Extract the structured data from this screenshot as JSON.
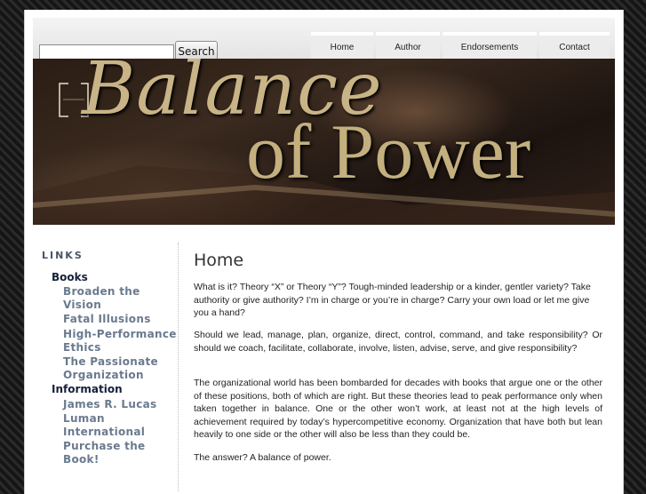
{
  "search": {
    "placeholder": "",
    "button_label": "Search"
  },
  "nav": [
    {
      "label": "Home"
    },
    {
      "label": "Author"
    },
    {
      "label": "Endorsements"
    },
    {
      "label": "Contact"
    }
  ],
  "banner": {
    "word1": "Balance",
    "word2": "of Power"
  },
  "sidebar": {
    "heading": "LINKS",
    "sections": [
      {
        "label": "Books",
        "links": [
          "Broaden the Vision",
          "Fatal Illusions",
          "High-Performance Ethics",
          "The Passionate Organization"
        ]
      },
      {
        "label": "Information",
        "links": [
          "James R. Lucas",
          "Luman International",
          "Purchase the Book!"
        ]
      }
    ]
  },
  "main": {
    "title": "Home",
    "paragraphs": [
      "What is it? Theory “X” or Theory “Y”? Tough-minded leadership or a kinder, gentler variety? Take authority or give authority? I’m in charge or you’re in charge? Carry your own load or let me give you a hand?",
      "Should we lead, manage, plan, organize, direct, control, command, and take responsibility? Or should we coach, facilitate, collaborate, involve, listen, advise, serve, and give responsibility?",
      "The organizational world has been bombarded for decades with books that argue one or the other of these positions, both of which are right. But these theories lead to peak performance only when taken together in balance. One or the other won’t work, at least not at the high levels of achievement required by today’s hypercompetitive economy. Organization that have both but lean heavily to one side or the other will also be less than they could be.",
      "The answer? A balance of power."
    ]
  }
}
